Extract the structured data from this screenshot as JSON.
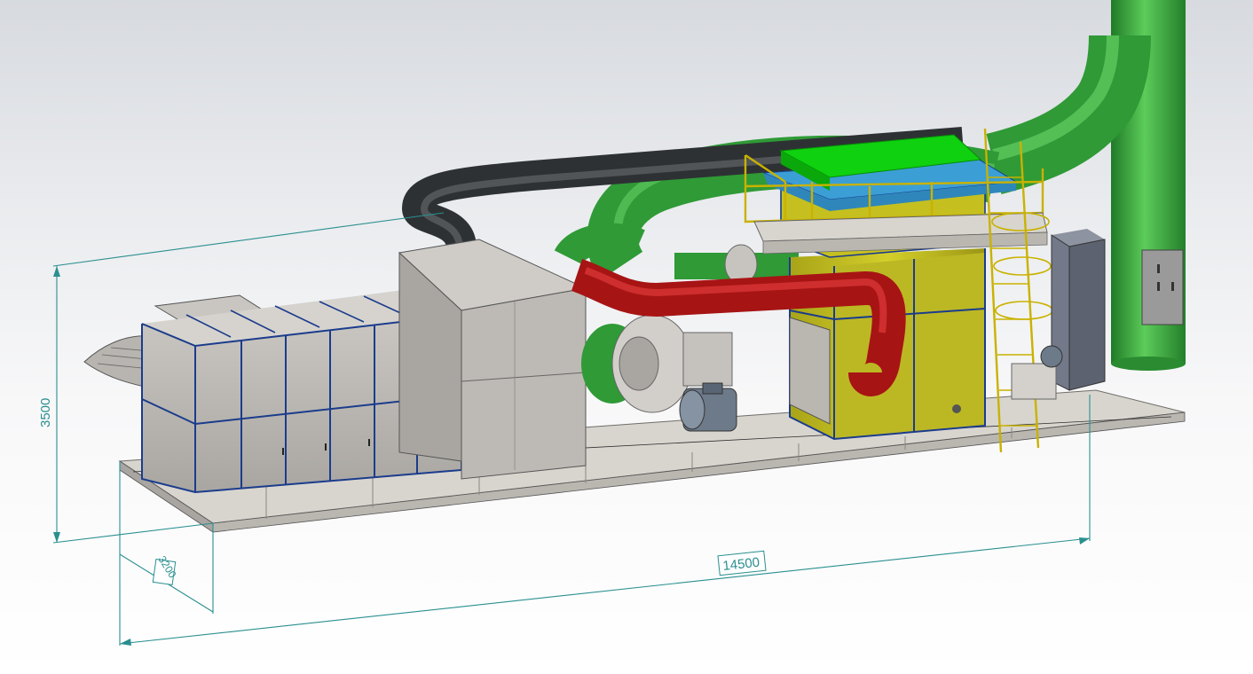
{
  "dimensions": {
    "height": "3500",
    "depth": "3200",
    "length": "14500"
  },
  "colors": {
    "pipe_green": "#3dae43",
    "pipe_red": "#c41a1a",
    "pipe_dark": "#3a3d40",
    "roof_green": "#0fd10f",
    "roof_blue": "#3b9fd6",
    "tower_yellow": "#c8c21d",
    "panel_grey": "#b6b3ae",
    "frame_blue": "#1b3c8c",
    "dimension": "#2a8f8f"
  }
}
